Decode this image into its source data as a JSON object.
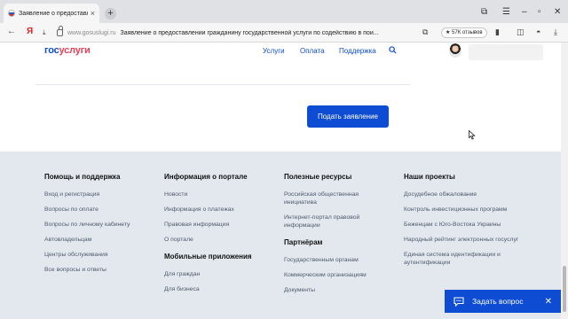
{
  "browser": {
    "tab_title": "Заявление о предоставлени...",
    "tab_close": "×",
    "new_tab": "+",
    "domain": "www.gosuslugi.ru",
    "page_title": "Заявление о предоставлении гражданину государственной услуги по содействию в пои...",
    "rating": "★ 57К отзывов",
    "yandex_letter": "Я"
  },
  "site": {
    "logo_part1": "гос",
    "logo_part2": "услуги",
    "menu": [
      "Услуги",
      "Оплата",
      "Поддержка"
    ]
  },
  "main": {
    "submit_label": "Подать заявление"
  },
  "footer": {
    "col1": {
      "title": "Помощь и поддержка",
      "links": [
        "Вход и регистрация",
        "Вопросы по оплате",
        "Вопросы по личному кабинету",
        "Автовладельцам",
        "Центры обслуживания",
        "Все вопросы и ответы"
      ]
    },
    "col2": {
      "title": "Информация о портале",
      "links": [
        "Новости",
        "Информация о платежах",
        "Правовая информация",
        "О портале"
      ],
      "sub_title": "Мобильные приложения",
      "sub_links": [
        "Для граждан",
        "Для бизнеса"
      ]
    },
    "col3": {
      "title": "Полезные ресурсы",
      "links": [
        "Российская общественная инициатива",
        "Интернет-портал правовой информации"
      ],
      "sub_title": "Партнёрам",
      "sub_links": [
        "Государственным органам",
        "Коммерческим организациям",
        "Документы"
      ]
    },
    "col4": {
      "title": "Наши проекты",
      "links": [
        "Досудебное обжалование",
        "Контроль инвестиционных программ",
        "Беженцам с Юго-Востока Украины",
        "Народный рейтинг электронных госуслуг",
        "Единая система идентификации и аутентификации"
      ]
    }
  },
  "chat": {
    "label": "Задать вопрос",
    "close": "✕"
  },
  "colors": {
    "brand_blue": "#0d4cd3",
    "brand_red": "#ee3f58",
    "footer_bg": "#e3e8ee"
  }
}
